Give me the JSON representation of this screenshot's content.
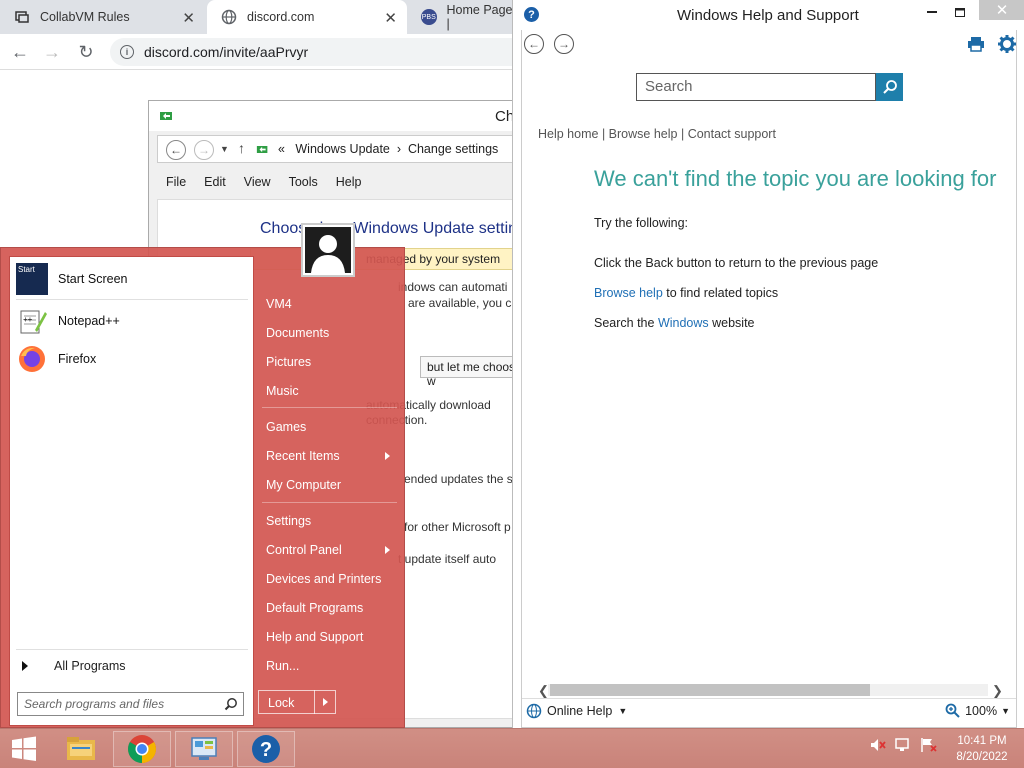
{
  "browser": {
    "tabs": [
      {
        "label": "CollabVM Rules",
        "active": false
      },
      {
        "label": "discord.com",
        "active": true
      },
      {
        "label": "Home Page | ",
        "active": false
      }
    ],
    "url": "discord.com/invite/aaPrvyr"
  },
  "windows_update": {
    "title_fragment": "Ch",
    "breadcrumb": {
      "root_glyph": "«",
      "item1": "Windows Update",
      "separator": "›",
      "item2": "Change settings"
    },
    "menu": [
      "File",
      "Edit",
      "View",
      "Tools",
      "Help"
    ],
    "heading": "Choose how Windows Update settings",
    "managed_notice": "managed by your system",
    "lines": [
      "indows can automati",
      "are available, you ca",
      "but let me choose w",
      "automatically download",
      "connection.",
      "ended updates the s",
      "for other Microsoft p",
      "t update itself auto"
    ]
  },
  "start_menu": {
    "pinned": [
      {
        "label": "Start Screen",
        "icon": "start-screen-icon",
        "icon_text": "Start"
      },
      {
        "label": "Notepad++",
        "icon": "notepadpp-icon"
      },
      {
        "label": "Firefox",
        "icon": "firefox-icon"
      }
    ],
    "all_programs": "All Programs",
    "search_placeholder": "Search programs and files",
    "right_items": [
      {
        "label": "VM4",
        "submenu": false
      },
      {
        "label": "Documents",
        "submenu": false
      },
      {
        "label": "Pictures",
        "submenu": false
      },
      {
        "label": "Music",
        "submenu": false
      },
      {
        "label": "Games",
        "submenu": false
      },
      {
        "label": "Recent Items",
        "submenu": true
      },
      {
        "label": "My Computer",
        "submenu": false
      },
      {
        "label": "Settings",
        "submenu": false
      },
      {
        "label": "Control Panel",
        "submenu": true
      },
      {
        "label": "Devices and Printers",
        "submenu": false
      },
      {
        "label": "Default Programs",
        "submenu": false
      },
      {
        "label": "Help and Support",
        "submenu": false
      },
      {
        "label": "Run...",
        "submenu": false
      }
    ],
    "lock_label": "Lock"
  },
  "help": {
    "window_title": "Windows Help and Support",
    "search_placeholder": "Search",
    "links": {
      "help_home": "Help home",
      "browse_help": "Browse help",
      "contact_support": "Contact support",
      "separator": "|"
    },
    "heading": "We can't find the topic you are looking for",
    "try_following": "Try the following:",
    "tip1": "Click the Back button to return to the previous page",
    "tip2_link": "Browse help",
    "tip2_text": " to find related topics",
    "tip3_text": "Search the ",
    "tip3_link": "Windows",
    "tip3_suffix": " website",
    "status_online": "Online Help",
    "zoom": "100%",
    "accent_color": "#3aa19b"
  },
  "taskbar": {
    "time": "10:41 PM",
    "date": "8/20/2022",
    "apps": [
      "windows-logo-icon",
      "file-explorer-icon",
      "chrome-icon",
      "control-panel-icon",
      "help-icon"
    ]
  }
}
